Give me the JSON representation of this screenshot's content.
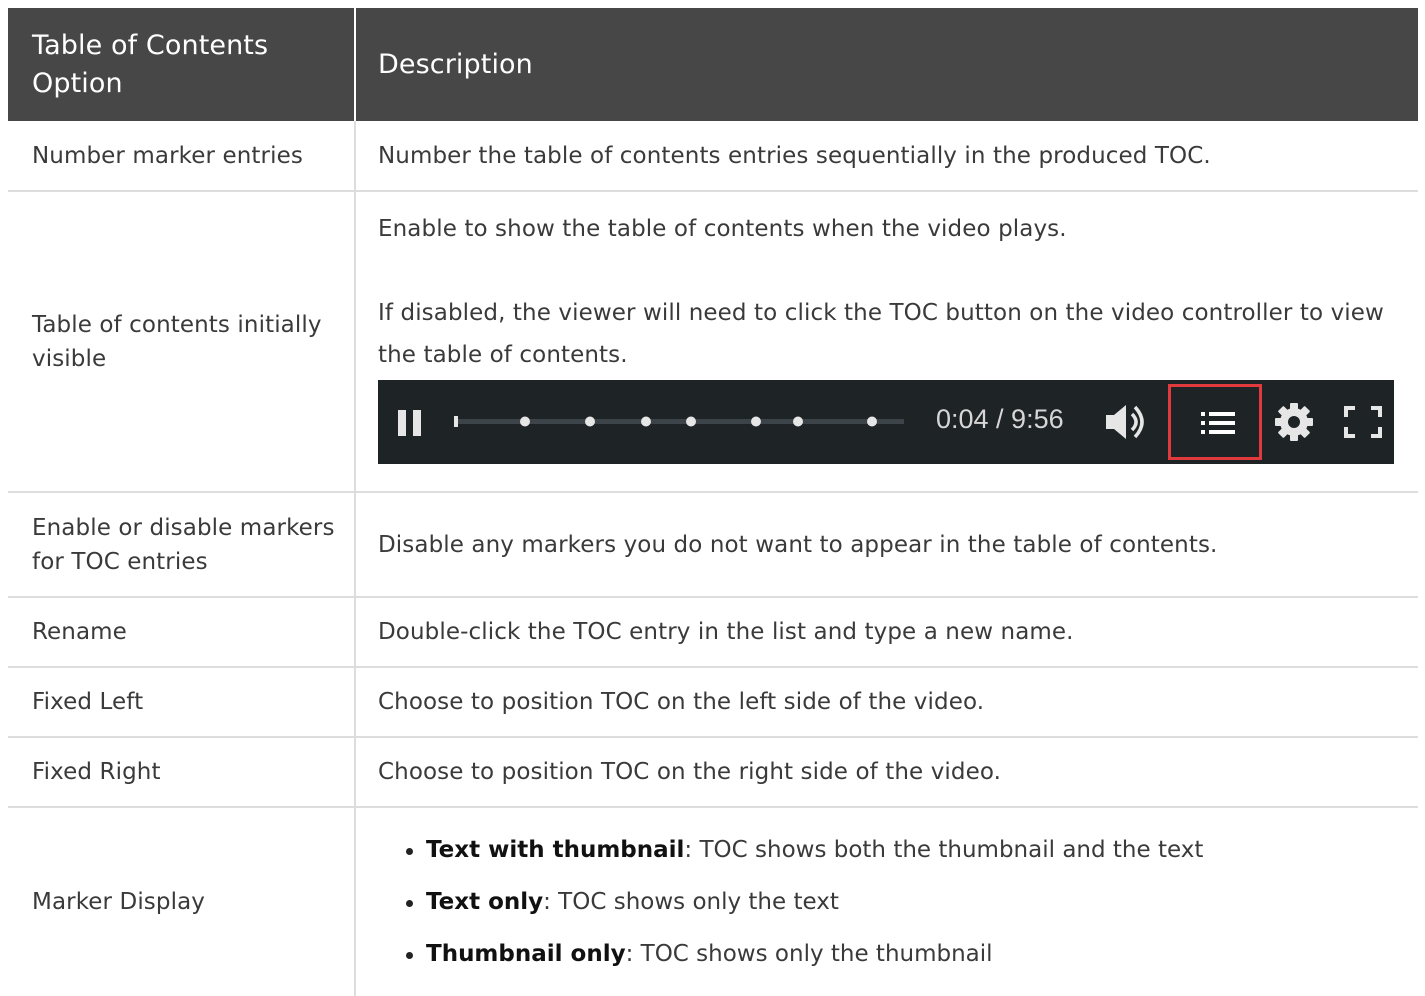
{
  "table": {
    "headers": [
      "Table of Contents Option",
      "Description"
    ],
    "rows": [
      {
        "option": "Number marker entries",
        "description": "Number the table of contents entries sequentially in the produced TOC."
      },
      {
        "option": "Table of contents initially visible",
        "description": "Enable to show the table of contents when the video plays.",
        "description_2": "If disabled, the viewer will need to click the TOC button on the video controller to view the table of contents.",
        "player": {
          "time": "0:04 / 9:56",
          "icons": [
            "pause-icon",
            "volume-icon",
            "toc-list-icon",
            "gear-icon",
            "fullscreen-icon"
          ],
          "highlight_color": "#e0393e",
          "background_color": "#1e2326"
        }
      },
      {
        "option": "Enable or disable markers for TOC entries",
        "description": "Disable any markers you do not want to appear in the table of contents."
      },
      {
        "option": "Rename",
        "description": "Double-click the TOC entry in the list and type a new name."
      },
      {
        "option": "Fixed Left",
        "description": "Choose to position TOC on the left side of the video."
      },
      {
        "option": "Fixed Right",
        "description": "Choose to position TOC on the right side of the video."
      },
      {
        "option": "Marker Display",
        "bullets": [
          {
            "term": "Text with thumbnail",
            "text": ": TOC shows both the thumbnail and the text"
          },
          {
            "term": "Text only",
            "text": ": TOC shows only the text"
          },
          {
            "term": "Thumbnail only",
            "text": ": TOC shows only the thumbnail"
          }
        ]
      }
    ]
  },
  "colors": {
    "header_bg": "#474747",
    "border": "#dddddd"
  }
}
